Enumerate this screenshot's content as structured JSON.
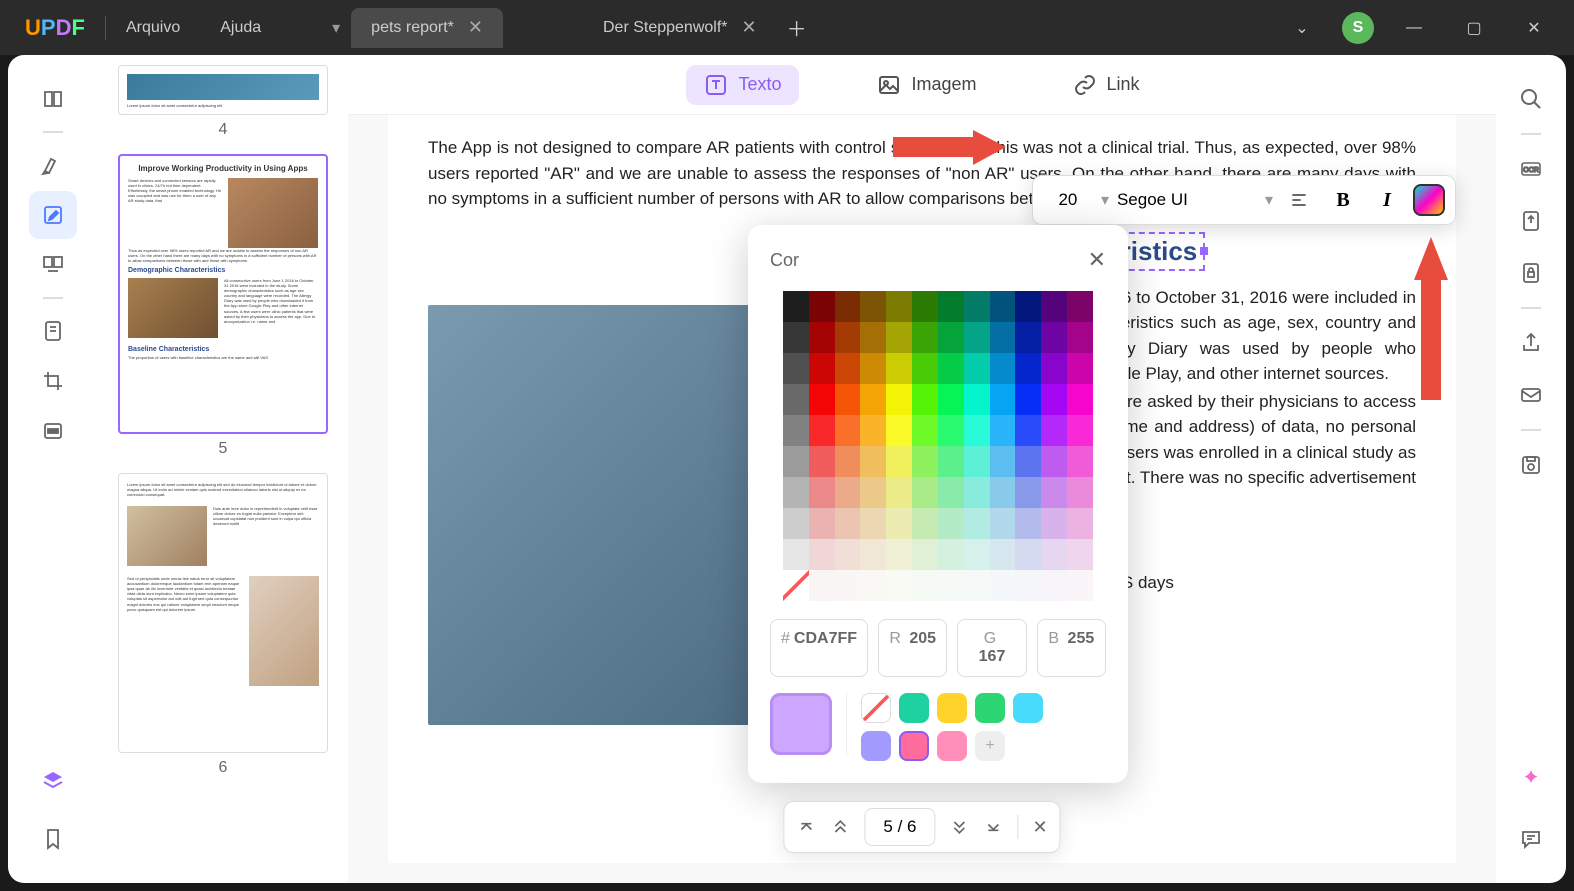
{
  "title_bar": {
    "menu_file": "Arquivo",
    "menu_help": "Ajuda",
    "avatar_initial": "S"
  },
  "tabs": [
    {
      "label": "pets report*",
      "active": true
    },
    {
      "label": "Der Steppenwolf*",
      "active": false
    }
  ],
  "top_toolbar": {
    "text_label": "Texto",
    "image_label": "Imagem",
    "link_label": "Link"
  },
  "thumbnails": [
    {
      "num": "4"
    },
    {
      "num": "5",
      "selected": true,
      "title": "Improve Working Productivity in Using Apps",
      "h1": "Demographic Characteristics",
      "h2": "Baseline Characteristics"
    },
    {
      "num": "6"
    }
  ],
  "document": {
    "para1": "The App is not designed to compare AR patients with control subjects and this was not a clinical trial. Thus, as expected, over 98% users reported \"AR\" and we are unable to assess the responses of \"non AR\" users. On the other hand, there are many days with no symptoms in a sufficient number of persons with AR to allow comparisons between ou",
    "heading1": "Demographic Characteristics",
    "para2": "All consecutive users from June 1, 2016 to October 31, 2016 were included in the study. Some demographic characteristics such as age, sex, country and language were recorded. The Allergy Diary was used by people who downloaded it from the App store, Google Play, and other internet sources.",
    "para3": "A few users were clinic patients that were asked by their physicians to access the app. Due to anonymization (i.e. name and address) of data, no personal identifiers were gathered. None of the users was enrolled in a clinical study as we aimed to have a real life assessment. There was no specific advertisement or other recruitment campaign (35).",
    "heading2": "Baseline Characteristics",
    "para4": "The proportion of users with baseline                                                                                             AS days"
  },
  "format_toolbar": {
    "font_size": "20",
    "font_name": "Segoe UI"
  },
  "color_panel": {
    "title": "Cor",
    "hex_prefix": "#",
    "hex_value": "CDA7FF",
    "r_prefix": "R",
    "r_value": "205",
    "g_prefix": "G",
    "g_value": "167",
    "b_prefix": "B",
    "b_value": "255",
    "swatches": [
      "none",
      "#1dd1a1",
      "#ffd32a",
      "#2ed573",
      "#48dbfb",
      "#a29bfe",
      "#ff6b9d"
    ]
  },
  "page_nav": {
    "current": "5",
    "total": "6",
    "sep": "/"
  }
}
